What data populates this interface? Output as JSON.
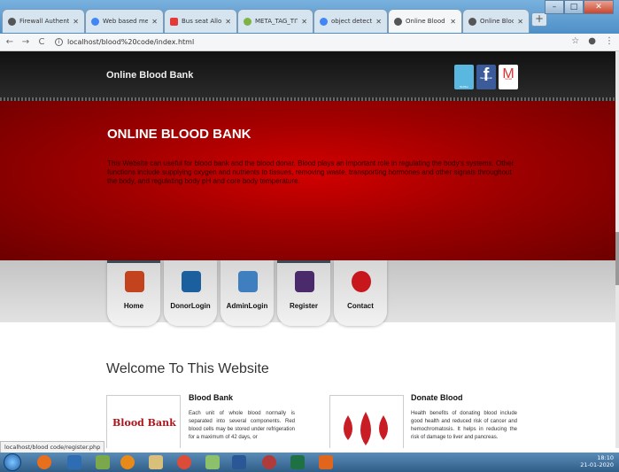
{
  "browser": {
    "tabs": [
      {
        "label": "Firewall Authenticat",
        "color": "#555"
      },
      {
        "label": "Web based meetin",
        "color": "#4285f4"
      },
      {
        "label": "Bus seat Allocation",
        "color": "#e53935"
      },
      {
        "label": "META_TAG_TITLE",
        "color": "#7cb342"
      },
      {
        "label": "object detection w",
        "color": "#4285f4"
      },
      {
        "label": "Online Blood Bank",
        "color": "#555"
      },
      {
        "label": "Online Blood Bank",
        "color": "#555"
      }
    ],
    "url": "localhost/blood%20code/index.html"
  },
  "site": {
    "name": "Online Blood Bank",
    "social": {
      "twitter": "Twitter",
      "facebook": "f",
      "facebook_label": "facebook",
      "gmail": "M",
      "gmail_label": "Gmail"
    },
    "banner": {
      "title": "ONLINE BLOOD BANK",
      "text": "This Website can useful for blood bank and the blood donar. Blood plays an important role in regulating the body's systems. Other functions include supplying oxygen and nutrients to tissues, removing waste, transporting hormones and other signals throughout the body, and regulating body pH and core body temperature."
    },
    "menu": [
      {
        "label": "Home",
        "icon": "home-icon",
        "color": "#c2431e"
      },
      {
        "label": "DonorLogin",
        "icon": "donor-icon",
        "color": "#1c5f9e"
      },
      {
        "label": "AdminLogin",
        "icon": "admin-icon",
        "color": "#3f7fbf"
      },
      {
        "label": "Register",
        "icon": "register-icon",
        "color": "#4a2a6a"
      },
      {
        "label": "Contact",
        "icon": "phone-icon",
        "color": "#c8161d"
      }
    ],
    "welcome": "Welcome To This Website",
    "cards": [
      {
        "title": "Blood Bank",
        "image_text": "Blood Bank",
        "text": "Each unit of whole blood normally is separated into several components. Red blood cells may be stored under refrigeration for a maximum of 42 days, or"
      },
      {
        "title": "Donate Blood",
        "text": "Health benefits of donating blood include good health and reduced risk of cancer and hemochromatosis. It helps in reducing the risk of damage to liver and pancreas."
      }
    ]
  },
  "status_url": "localhost/blood code/register.php",
  "tray": {
    "time": "18:10",
    "date": "21-01-2020"
  }
}
